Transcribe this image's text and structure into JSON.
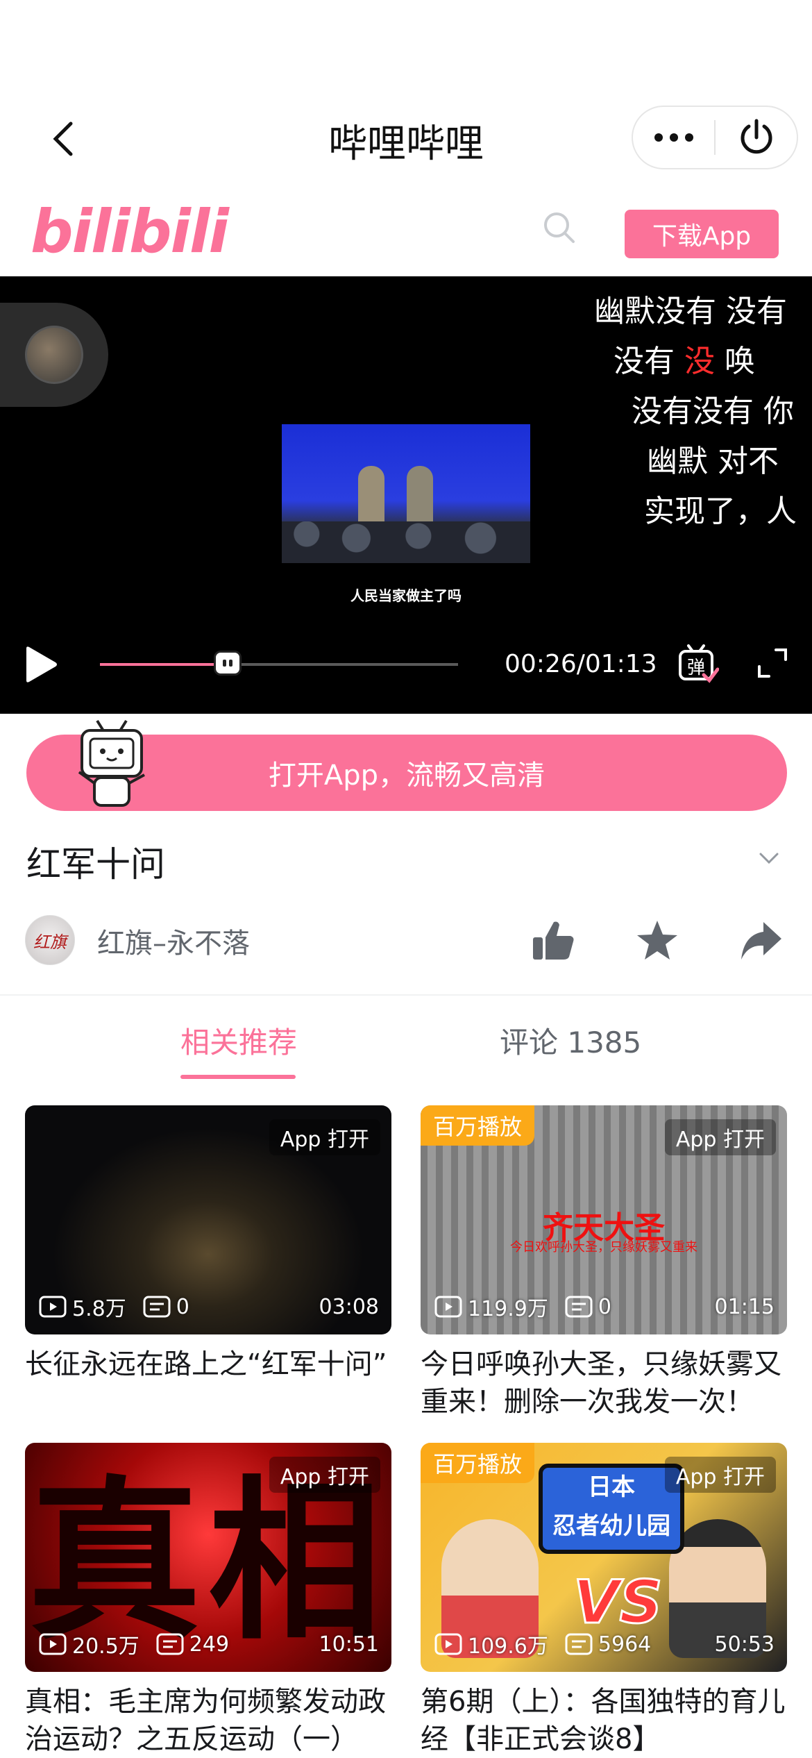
{
  "nav": {
    "title": "哔哩哔哩"
  },
  "header": {
    "logo_text": "bilibili",
    "download_label": "下载App"
  },
  "player": {
    "subtitle": "人民当家做主了吗",
    "danmaku": [
      {
        "text": "幽默没有    没有"
      },
      {
        "pre": "没有 ",
        "red": "没",
        "post": "       唤"
      },
      {
        "text": "没有没有  你"
      },
      {
        "text": "幽默    对不"
      },
      {
        "text": "实现了，人"
      }
    ],
    "time": "00:26/01:13",
    "progress": 0.356,
    "danmaku_label": "弹"
  },
  "open_app_label": "打开App，流畅又高清",
  "video": {
    "title": "红军十问"
  },
  "author": {
    "name": "红旗–永不落",
    "avatar_text": "红旗"
  },
  "tabs": [
    {
      "label": "相关推荐",
      "active": true
    },
    {
      "label": "评论 1385",
      "active": false
    }
  ],
  "cards": [
    {
      "badge": "",
      "app_open": "App 打开",
      "views": "5.8万",
      "danmaku": "0",
      "duration": "03:08",
      "title": "长征永远在路上之“红军十问”"
    },
    {
      "badge": "百万播放",
      "app_open": "App 打开",
      "views": "119.9万",
      "danmaku": "0",
      "duration": "01:15",
      "title": "今日呼唤孙大圣，只缘妖雾又重来！删除一次我发一次！",
      "cover_text": "齐天大圣",
      "cover_sub": "今日欢呼孙大圣，只缘妖雾又重来"
    },
    {
      "badge": "",
      "app_open": "App 打开",
      "views": "20.5万",
      "danmaku": "249",
      "duration": "10:51",
      "title": "真相：毛主席为何频繁发动政治运动？之五反运动（一）",
      "cover_text": "真相"
    },
    {
      "badge": "百万播放",
      "app_open": "App 打开",
      "views": "109.6万",
      "danmaku": "5964",
      "duration": "50:53",
      "title": "第6期（上）：各国独特的育儿经【非正式会谈8】",
      "cover_show_line1": "日本",
      "cover_show_line2": "忍者幼儿园",
      "cover_vs": "VS"
    }
  ],
  "colors": {
    "accent": "#fb7299",
    "badge": "#fba918"
  }
}
